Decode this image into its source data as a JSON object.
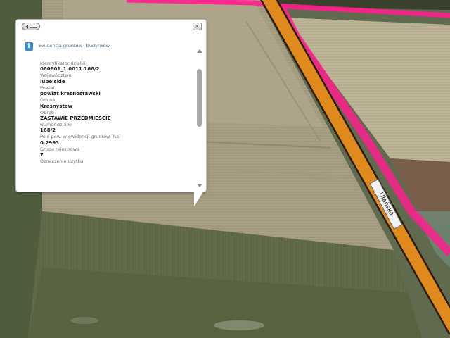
{
  "map": {
    "street_name": "Ułańska",
    "colors": {
      "road_fill": "#e08a1e",
      "road_edge": "#2a1a08",
      "parcel_boundary": "#ff1f8e"
    }
  },
  "popup": {
    "layer_title": "Ewidencja gruntów i budynków",
    "attributes": [
      {
        "label": "Identyfikator działki",
        "value": "060601_1.0011.168/2"
      },
      {
        "label": "Województwo",
        "value": "lubelskie"
      },
      {
        "label": "Powiat",
        "value": "powiat krasnostawski"
      },
      {
        "label": "Gmina",
        "value": "Krasnystaw"
      },
      {
        "label": "Obręb",
        "value": "ZASTAWIE PRZEDMIEŚCIE"
      },
      {
        "label": "Numer działki",
        "value": "168/2"
      },
      {
        "label": "Pole pow. w ewidencji gruntów (ha)",
        "value": "0.2993"
      },
      {
        "label": "Grupa rejestrowa",
        "value": "7"
      },
      {
        "label": "Oznaczenie użytku",
        "value": ""
      }
    ],
    "icons": {
      "nav": "back-arrow-icon",
      "close": "close-icon",
      "layer": "info-icon"
    }
  }
}
